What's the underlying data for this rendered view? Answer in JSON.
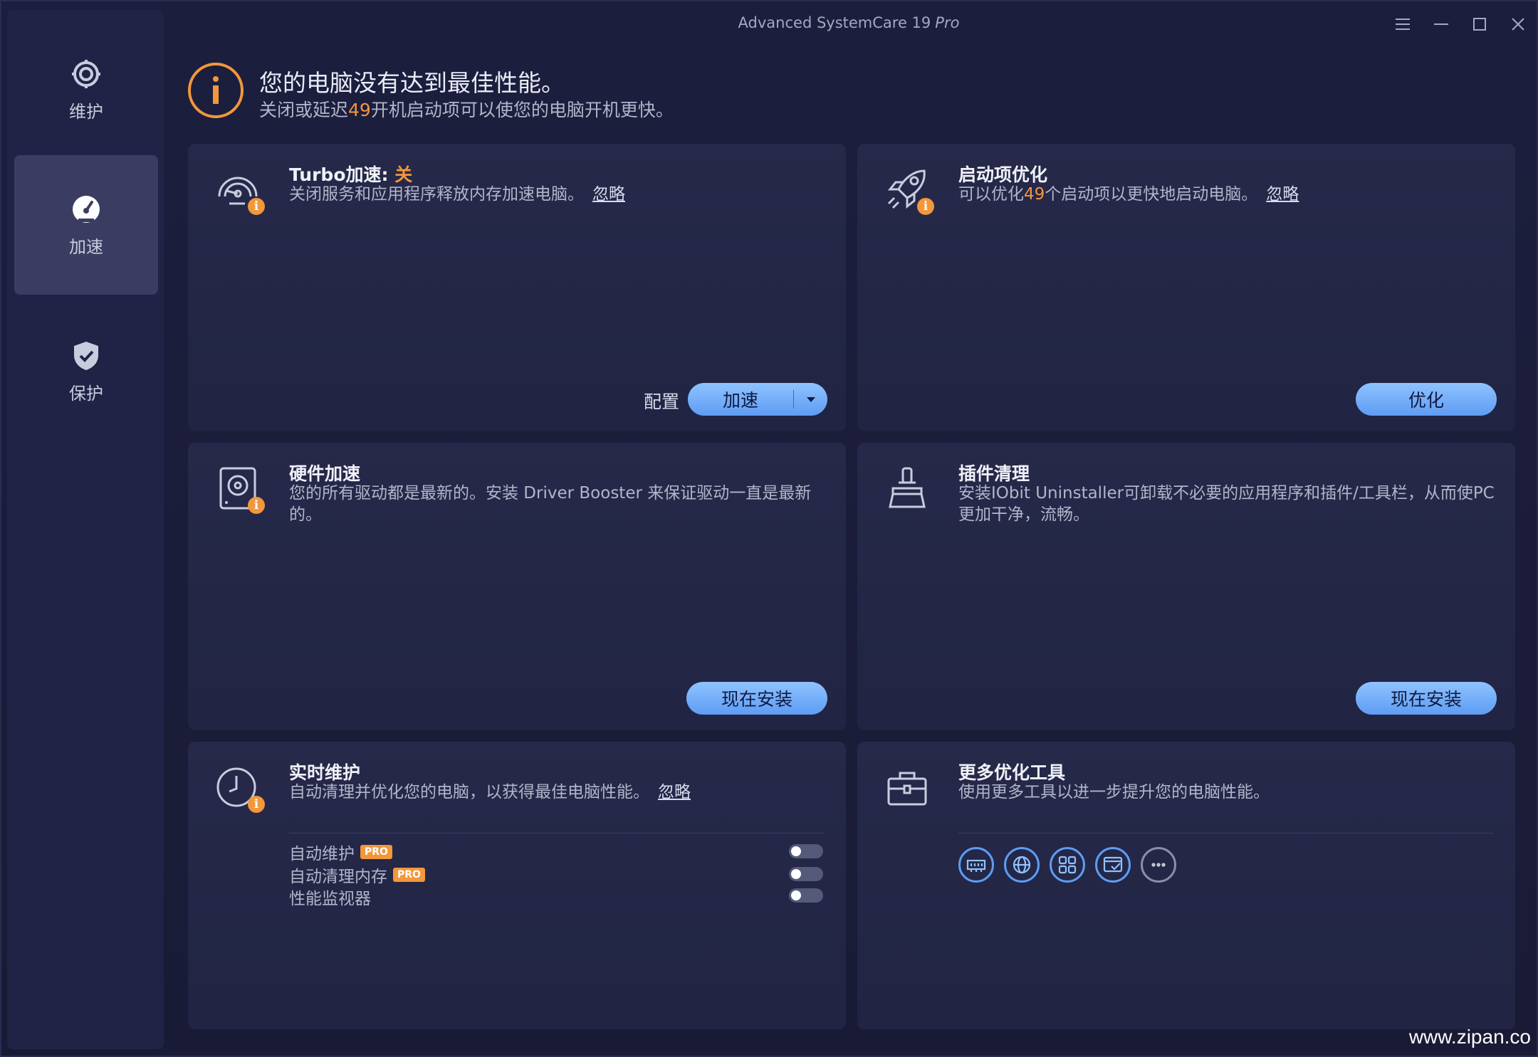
{
  "window": {
    "title": "Advanced SystemCare 19",
    "edition": "Pro"
  },
  "sidebar": {
    "items": [
      {
        "label": "维护",
        "icon": "gear-icon",
        "active": false
      },
      {
        "label": "加速",
        "icon": "speedometer-icon",
        "active": true
      },
      {
        "label": "保护",
        "icon": "shield-check-icon",
        "active": false
      }
    ]
  },
  "banner": {
    "title": "您的电脑没有达到最佳性能。",
    "sub_pre": "关闭或延迟",
    "sub_count": "49",
    "sub_post": "开机启动项可以使您的电脑开机更快。"
  },
  "cards": {
    "turbo": {
      "title": "Turbo加速: ",
      "status": "关",
      "desc": "关闭服务和应用程序释放内存加速电脑。",
      "ignore": "忽略",
      "config": "配置",
      "button": "加速"
    },
    "startup": {
      "title": "启动项优化",
      "desc_pre": "可以优化",
      "desc_count": "49",
      "desc_post": "个启动项以更快地启动电脑。",
      "ignore": "忽略",
      "button": "优化"
    },
    "hardware": {
      "title": "硬件加速",
      "desc": "您的所有驱动都是最新的。安装 Driver Booster 来保证驱动一直是最新的。",
      "button": "现在安装"
    },
    "plugin": {
      "title": "插件清理",
      "desc": "安装IObit Uninstaller可卸载不必要的应用程序和插件/工具栏，从而使PC更加干净，流畅。",
      "button": "现在安装"
    },
    "realtime": {
      "title": "实时维护",
      "desc": "自动清理并优化您的电脑，以获得最佳电脑性能。",
      "ignore": "忽略",
      "toggles": [
        {
          "label": "自动维护",
          "pro": "PRO",
          "on": false
        },
        {
          "label": "自动清理内存",
          "pro": "PRO",
          "on": false
        },
        {
          "label": "性能监视器",
          "pro": "",
          "on": false
        }
      ]
    },
    "tools": {
      "title": "更多优化工具",
      "desc": "使用更多工具以进一步提升您的电脑性能。",
      "tool_icons": [
        "ram-icon",
        "globe-icon",
        "apps-grid-icon",
        "window-check-icon",
        "more-icon"
      ]
    }
  },
  "watermark": "www.zipan.co"
}
